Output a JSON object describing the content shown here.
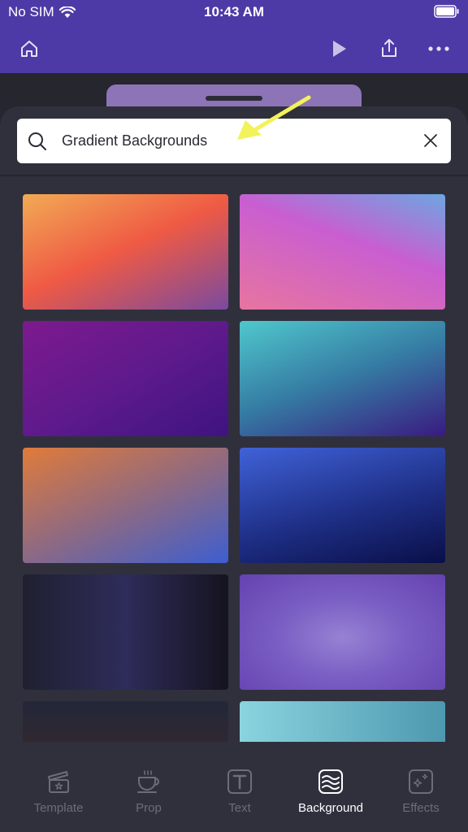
{
  "status": {
    "carrier": "No SIM",
    "time": "10:43 AM"
  },
  "toolbar": {
    "home_icon": "home-icon",
    "play_icon": "play-icon",
    "share_icon": "share-icon",
    "more_icon": "more-icon"
  },
  "search": {
    "value": "Gradient Backgrounds",
    "placeholder": "Search"
  },
  "tabs": [
    {
      "label": "Template",
      "icon": "clapperboard-star-icon",
      "active": false
    },
    {
      "label": "Prop",
      "icon": "coffee-cup-icon",
      "active": false
    },
    {
      "label": "Text",
      "icon": "text-box-icon",
      "active": false
    },
    {
      "label": "Background",
      "icon": "layers-wave-icon",
      "active": true
    },
    {
      "label": "Effects",
      "icon": "sparkle-box-icon",
      "active": false
    }
  ],
  "colors": {
    "header": "#4e3aa6",
    "sheet": "#30303d",
    "active_tab": "#ffffff",
    "inactive_tab": "#6d6d78",
    "annotation_arrow": "#f2f25a"
  }
}
